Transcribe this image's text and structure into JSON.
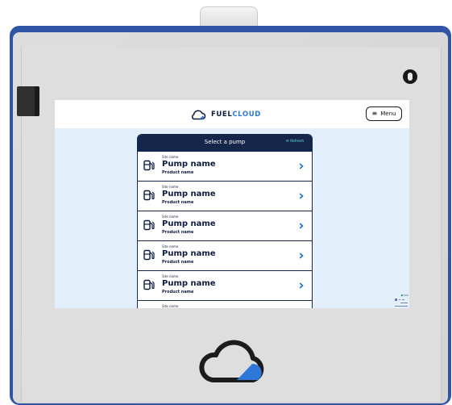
{
  "app": {
    "brand_prefix": "FUEL",
    "brand_suffix": "CLOUD"
  },
  "header": {
    "menu_label": "Menu",
    "menu_icon": "hamburger-icon"
  },
  "panel": {
    "title": "Select a pump",
    "refresh_label": "Refresh",
    "refresh_icon": "refresh-icon"
  },
  "pumps": [
    {
      "site": "Site name",
      "pump": "Pump name",
      "product": "Product name"
    },
    {
      "site": "Site name",
      "pump": "Pump name",
      "product": "Product name"
    },
    {
      "site": "Site name",
      "pump": "Pump name",
      "product": "Product name"
    },
    {
      "site": "Site name",
      "pump": "Pump name",
      "product": "Product name"
    },
    {
      "site": "Site name",
      "pump": "Pump name",
      "product": "Product name"
    },
    {
      "site": "Site name"
    }
  ],
  "colors": {
    "device_blue": "#2f55a4",
    "navy": "#16254a",
    "accent_blue": "#2f77d8",
    "screen_bg": "#e3f0fc",
    "refresh_cyan": "#62e0ee"
  }
}
